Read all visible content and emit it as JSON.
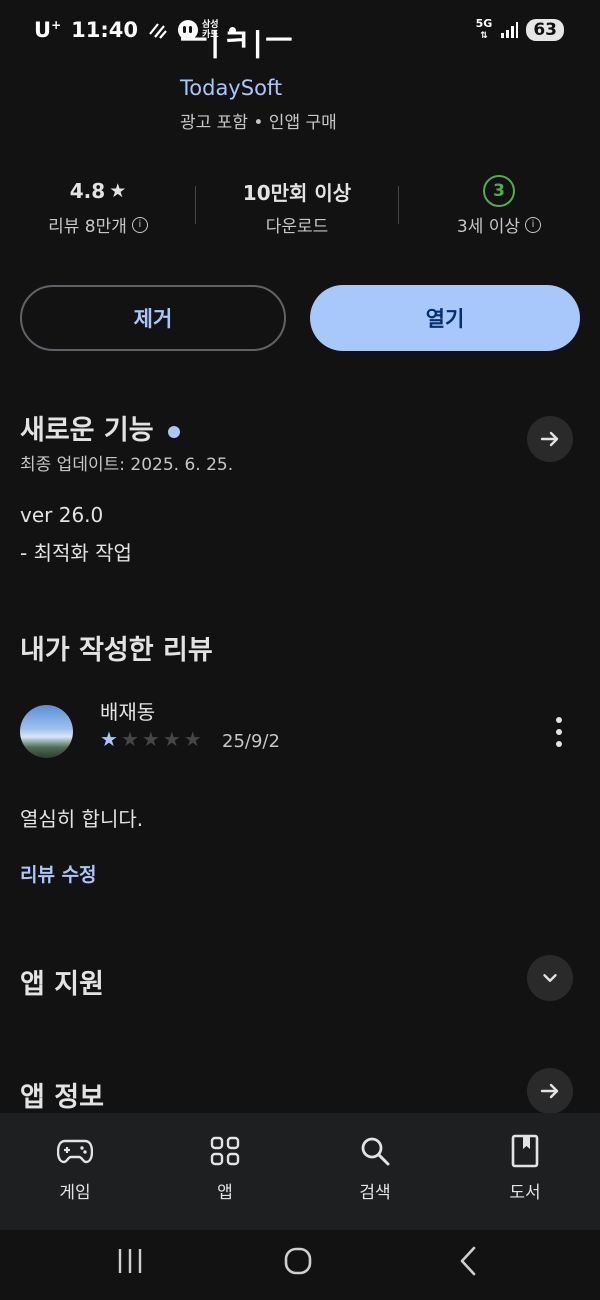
{
  "status_bar": {
    "carrier": "U",
    "carrier_sup": "+",
    "time": "11:40",
    "samsung_card_line1": "삼성",
    "samsung_card_line2": "카드",
    "network": "5G",
    "battery": "63"
  },
  "app": {
    "title_partial": "ㅡ|ㅋ|ㅡ 밈",
    "developer": "TodaySoft",
    "meta": "광고 포함 • 인앱 구매"
  },
  "stats": {
    "rating_value": "4.8",
    "rating_label": "리뷰 8만개",
    "downloads_value": "10만회 이상",
    "downloads_label": "다운로드",
    "age_badge": "3",
    "age_label": "3세 이상"
  },
  "actions": {
    "remove_label": "제거",
    "open_label": "열기"
  },
  "whats_new": {
    "title": "새로운 기능",
    "updated": "최종 업데이트: 2025. 6. 25.",
    "version": "ver 26.0",
    "notes": "- 최적화 작업"
  },
  "my_review": {
    "section_title": "내가 작성한 리뷰",
    "user_name": "배재동",
    "rating": 1,
    "rating_max": 5,
    "date": "25/9/2",
    "text": "열심히 합니다.",
    "edit_label": "리뷰 수정"
  },
  "app_support": {
    "title": "앱 지원"
  },
  "app_info": {
    "title": "앱 정보"
  },
  "bottom_nav": {
    "items": [
      {
        "label": "게임",
        "icon": "gamepad-icon"
      },
      {
        "label": "앱",
        "icon": "apps-grid-icon"
      },
      {
        "label": "검색",
        "icon": "search-icon"
      },
      {
        "label": "도서",
        "icon": "book-icon"
      }
    ]
  },
  "colors": {
    "background": "#121212",
    "accent": "#a8c7fa",
    "age_green": "#4caf50"
  }
}
